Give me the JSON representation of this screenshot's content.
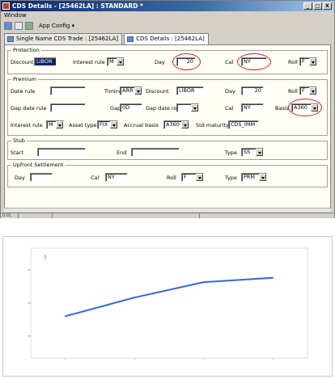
{
  "window": {
    "title": "CDS Details - [25462LA] : STANDARD *",
    "buttons": [
      "_",
      "□",
      "X"
    ]
  },
  "menu": {
    "items": [
      "Window"
    ]
  },
  "toolbar": {
    "app_config": "App Config ▾"
  },
  "tabs": [
    {
      "label": "Single Name CDS Trade : [25462LA]"
    },
    {
      "label": "CDS Details : [25462LA]"
    }
  ],
  "protection": {
    "legend": "Protection",
    "discount_label": "Discount",
    "discount_value": "LIBOR",
    "interest_rule_label": "Interest rule",
    "interest_rule_value": "M",
    "day_label": "Day",
    "day_value": "20",
    "cal_label": "Cal",
    "cal_value": "NY",
    "roll_label": "Roll",
    "roll_value": "F"
  },
  "premium": {
    "legend": "Premium",
    "date_rule_label": "Date rule",
    "date_rule_value": "",
    "timing_label": "Timing",
    "timing_value": "ARR",
    "discount_label": "Discount",
    "discount_value": "LIBOR",
    "day_label": "Day",
    "day_value": "20",
    "roll_label": "Roll",
    "roll_value": "F",
    "gap_date_rule_label": "Gap date rule",
    "gap_date_rule_value": "",
    "gap_label": "Gap",
    "gap_value": "0D",
    "gap_date_roll_label": "Gap date roll",
    "gap_date_roll_value": "",
    "cal_label": "Cal",
    "cal_value": "NY",
    "basis_label": "Basis",
    "basis_value": "A360",
    "interest_rule_label": "Interest rule",
    "interest_rule_value": "M",
    "asset_type_label": "Asset type",
    "asset_type_value": "FIX",
    "accrual_basis_label": "Accrual basis",
    "accrual_basis_value": "A360",
    "std_maturity_label": "Std maturity",
    "std_maturity_value": "CDS_IMM"
  },
  "stub": {
    "legend": "Stub",
    "start_label": "Start",
    "start_value": "",
    "end_label": "End",
    "end_value": "",
    "type_label": "Type",
    "type_value": "SS"
  },
  "upfront": {
    "legend": "Upfront Settlement",
    "day_label": "Day",
    "day_value": "",
    "cal_label": "Cal",
    "cal_value": "NY",
    "roll_label": "Roll",
    "roll_value": "F",
    "type_label": "Type",
    "type_value": "PRM"
  },
  "status": {
    "left": "0:01"
  },
  "colors": {
    "accent": "#0a246a",
    "highlight_circle": "#d02020",
    "line": "#3366dd"
  },
  "chart_data": {
    "type": "line",
    "title": "",
    "xlabel": "",
    "ylabel": "",
    "x": [
      1,
      2,
      3,
      4
    ],
    "series": [
      {
        "values": [
          0.38,
          0.55,
          0.69,
          0.73
        ]
      }
    ],
    "ylim": [
      0,
      1
    ],
    "xlim": [
      0.5,
      4.5
    ],
    "grid": false
  }
}
